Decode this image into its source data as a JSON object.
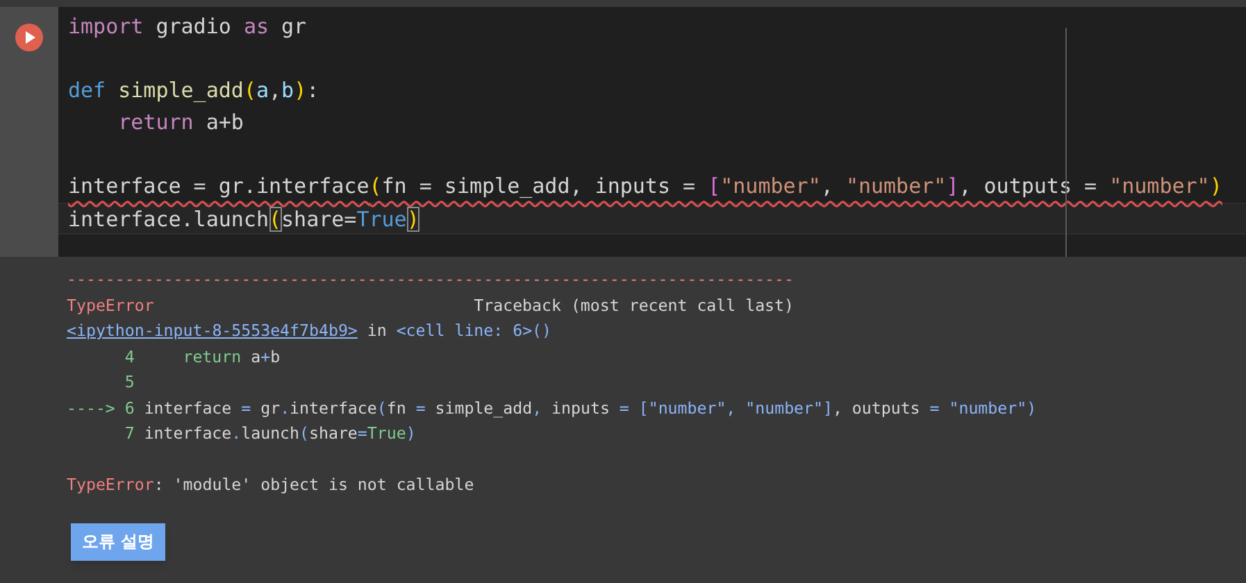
{
  "cell": {
    "lines": [
      {
        "tokens": [
          {
            "t": "import",
            "kind": "keyword"
          },
          {
            "t": " gradio ",
            "kind": "plain"
          },
          {
            "t": "as",
            "kind": "keyword"
          },
          {
            "t": " gr",
            "kind": "plain"
          }
        ]
      },
      {
        "gap_before": true,
        "tokens": [
          {
            "t": "def",
            "kind": "storage"
          },
          {
            "t": " simple_add",
            "kind": "function"
          },
          {
            "t": "(",
            "kind": "bracket"
          },
          {
            "t": "a",
            "kind": "param"
          },
          {
            "t": ",",
            "kind": "plain"
          },
          {
            "t": "b",
            "kind": "param"
          },
          {
            "t": ")",
            "kind": "bracket"
          },
          {
            "t": ":",
            "kind": "plain"
          }
        ]
      },
      {
        "indented": true,
        "tokens": [
          {
            "t": "return",
            "kind": "keyword"
          },
          {
            "t": " a+b",
            "kind": "plain"
          }
        ]
      },
      {
        "gap_before": true,
        "error_underline": true,
        "tokens": [
          {
            "t": "interface = gr.interface",
            "kind": "plain"
          },
          {
            "t": "(",
            "kind": "bracket"
          },
          {
            "t": "fn = simple_add, inputs = ",
            "kind": "plain"
          },
          {
            "t": "[",
            "kind": "bracket2"
          },
          {
            "t": "\"number\"",
            "kind": "string"
          },
          {
            "t": ", ",
            "kind": "plain"
          },
          {
            "t": "\"number\"",
            "kind": "string"
          },
          {
            "t": "]",
            "kind": "bracket2"
          },
          {
            "t": ", outputs = ",
            "kind": "plain"
          },
          {
            "t": "\"number\"",
            "kind": "string"
          },
          {
            "t": ")",
            "kind": "bracket"
          }
        ]
      },
      {
        "current": true,
        "tokens": [
          {
            "t": "interface.launch",
            "kind": "plain"
          },
          {
            "t": "(",
            "kind": "bracket",
            "matched": true
          },
          {
            "t": "share=",
            "kind": "plain"
          },
          {
            "t": "True",
            "kind": "constant"
          },
          {
            "t": ")",
            "kind": "bracket",
            "matched": true
          }
        ]
      }
    ]
  },
  "output": {
    "rows": [
      {
        "kind": "rule",
        "text": "---------------------------------------------------------------------------"
      },
      {
        "kind": "header",
        "error": "TypeError",
        "traceback": "Traceback (most recent call last)"
      },
      {
        "kind": "location",
        "tokens": [
          {
            "t": "<ipython-input-8-5553e4f7b4b9>",
            "kind": "link"
          },
          {
            "t": " in ",
            "kind": "plain"
          },
          {
            "t": "<cell line: 6>()",
            "kind": "blue"
          }
        ]
      },
      {
        "kind": "source",
        "number": "4",
        "indented": true,
        "tokens": [
          {
            "t": "return",
            "kind": "green"
          },
          {
            "t": " a",
            "kind": "plain"
          },
          {
            "t": "+",
            "kind": "blue"
          },
          {
            "t": "b",
            "kind": "plain"
          }
        ]
      },
      {
        "kind": "source",
        "number": "5"
      },
      {
        "kind": "source",
        "arrow": "---->",
        "number": "6",
        "tokens": [
          {
            "t": "interface",
            "kind": "plain"
          },
          {
            "t": " = ",
            "kind": "blue"
          },
          {
            "t": "gr",
            "kind": "plain"
          },
          {
            "t": ".",
            "kind": "blue"
          },
          {
            "t": "interface",
            "kind": "plain"
          },
          {
            "t": "(",
            "kind": "blue"
          },
          {
            "t": "fn ",
            "kind": "plain"
          },
          {
            "t": "=",
            "kind": "blue"
          },
          {
            "t": " simple_add",
            "kind": "plain"
          },
          {
            "t": ",",
            "kind": "blue"
          },
          {
            "t": " inputs ",
            "kind": "plain"
          },
          {
            "t": "= [\"number\", \"number\"]",
            "kind": "blue"
          },
          {
            "t": ", outputs ",
            "kind": "plain"
          },
          {
            "t": "= \"number\")",
            "kind": "blue"
          }
        ]
      },
      {
        "kind": "source",
        "number": "7",
        "tokens": [
          {
            "t": "interface",
            "kind": "plain"
          },
          {
            "t": ".",
            "kind": "blue"
          },
          {
            "t": "launch",
            "kind": "plain"
          },
          {
            "t": "(",
            "kind": "blue"
          },
          {
            "t": "share",
            "kind": "plain"
          },
          {
            "t": "=",
            "kind": "blue"
          },
          {
            "t": "True",
            "kind": "green"
          },
          {
            "t": ")",
            "kind": "blue"
          }
        ]
      },
      {
        "kind": "message",
        "tokens": [
          {
            "t": "TypeError",
            "kind": "red"
          },
          {
            "t": ": 'module' object is not callable",
            "kind": "plain"
          }
        ]
      }
    ],
    "button": "오류 설명"
  }
}
